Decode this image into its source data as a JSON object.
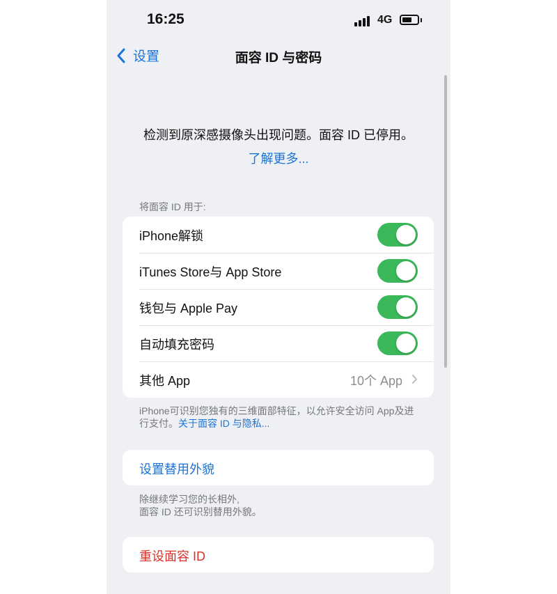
{
  "status_bar": {
    "time": "16:25",
    "network": "4G"
  },
  "nav": {
    "back_label": "设置",
    "title": "面容 ID 与密码"
  },
  "alert": {
    "message": "检测到原深感摄像头出现问题。面容 ID 已停用。",
    "learn_more": "了解更多..."
  },
  "section": {
    "header": "将面容 ID 用于:"
  },
  "rows": [
    {
      "label": "iPhone解锁",
      "enabled": true
    },
    {
      "label": "iTunes Store与 App Store",
      "enabled": true
    },
    {
      "label": "钱包与 Apple Pay",
      "enabled": true
    },
    {
      "label": "自动填充密码",
      "enabled": true
    },
    {
      "label": "其他 App",
      "value": "10个 App"
    }
  ],
  "footnote1": {
    "text": "iPhone可识别您独有的三维面部特征，以允许安全访问 App及进行支付。",
    "link": "关于面容 ID 与隐私..."
  },
  "alternate": {
    "label": "设置替用外貌"
  },
  "footnote2": {
    "line1": "除继续学习您的长相外,",
    "line2": "面容 ID 还可识别替用外貌。"
  },
  "reset": {
    "label": "重设面容 ID"
  },
  "colors": {
    "accent": "#1b74d8",
    "toggle_on": "#3bb85a",
    "destructive": "#d83228",
    "background": "#eef0f3"
  }
}
